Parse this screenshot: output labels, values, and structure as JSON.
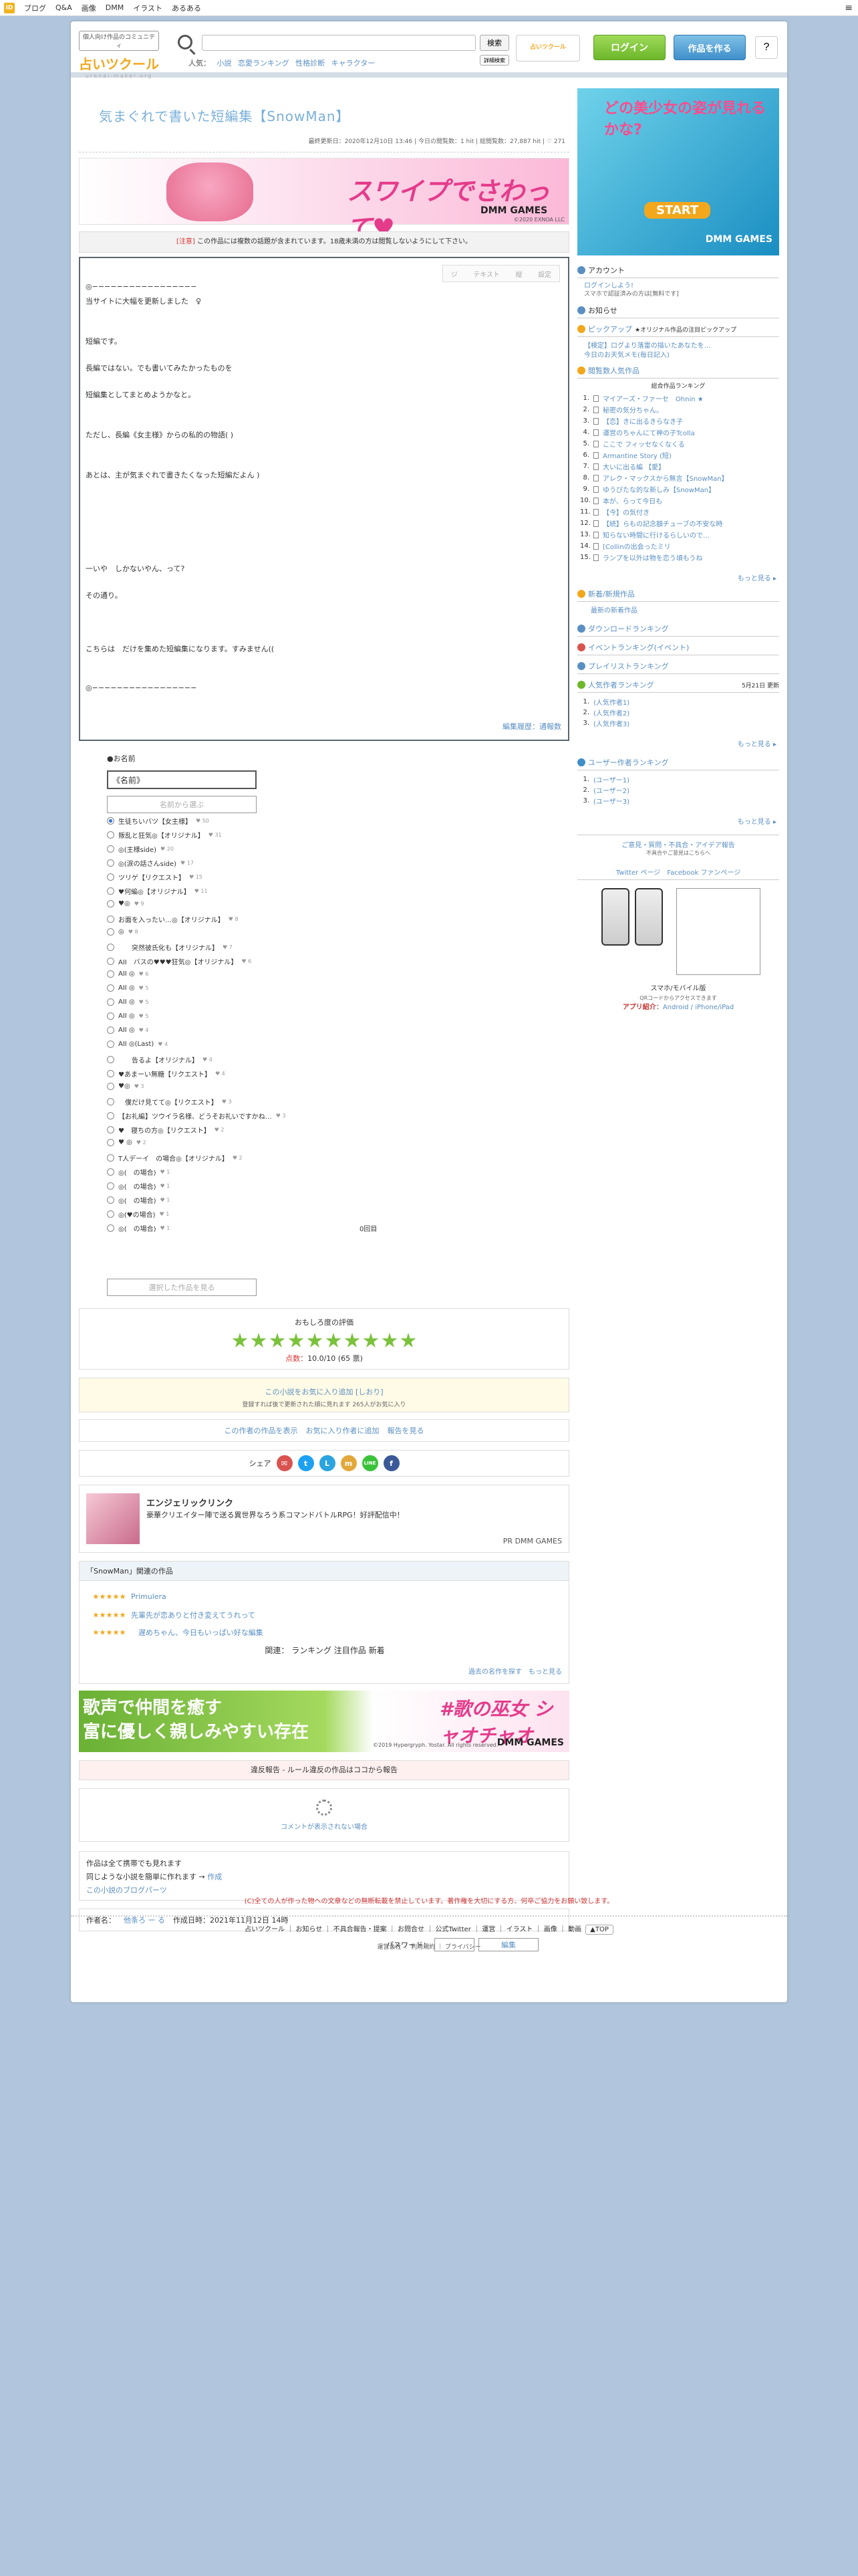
{
  "topbar": {
    "logo": "ID",
    "nav": [
      "ブログ",
      "Q&A",
      "画像",
      "DMM",
      "イラスト",
      "あるある"
    ],
    "menu_icon": "≡"
  },
  "header": {
    "tagline": "個人向け作品のコミュニティ",
    "brand": "占いツクール",
    "url": "uranai-maker.org",
    "search_placeholder": "",
    "search_button": "検索",
    "detail_button": "詳細検索",
    "suggest_label": "人気：",
    "suggest": [
      "小説",
      "恋愛ランキング",
      "性格診断",
      "キャラクター"
    ],
    "ad_label": "占いツクール",
    "login": "ログイン",
    "create": "作品を作る",
    "help_icon": "?"
  },
  "work": {
    "title": "気まぐれで書いた短編集【SnowMan】",
    "meta": "最終更新日：2020年12月10日 13:46 | 今日の閲覧数：1 hit | 総閲覧数：27,887 hit | ♡ 271",
    "warn_tag": "[注意]",
    "warn_text": "この作品には複数の話題が含まれています。18歳未満の方は閲覧しないようにして下さい。",
    "tools": [
      "ジ",
      "テキスト",
      "縦",
      "設定"
    ],
    "footer_link": "編集履歴：通報数"
  },
  "banner": {
    "text": "スワイプでさわって♥",
    "brand": "DMM GAMES",
    "copyright": "©2020 EXNOA LLC"
  },
  "novel": {
    "lines": [
      "◎−−−−−−−−−−−−−−−−−",
      "当サイトに大幅を更新しました　♀",
      "",
      "",
      "短編です。",
      "",
      "長編ではない。でも書いてみたかったものを",
      "",
      "短編集としてまとめようかなと。",
      "",
      "",
      "ただし、長編《女主様》からの私的の物語( )",
      "",
      "",
      "あとは、主が気まぐれで書きたくなった短編だよん )",
      "",
      "",
      "",
      "",
      "",
      "",
      "一いや　しかないやん、って?",
      "",
      "その通り。",
      "",
      "",
      "",
      "こちらは　だけを集めた短編集になります。すみません((",
      "",
      "",
      "◎−−−−−−−−−−−−−−−−−"
    ]
  },
  "vote": {
    "heading": "●お名前",
    "name_value": "《名前》",
    "search_button": "名前から選ぶ",
    "options": [
      {
        "label": "生徒ちいバツ【女主様】",
        "votes": "♥ 50"
      },
      {
        "label": "叛乱と狂気◎【オリジナル】",
        "votes": "♥ 31"
      },
      {
        "label": "◎(主様side)",
        "votes": "♥ 20"
      },
      {
        "label": "◎(涙の話さんside)",
        "votes": "♥ 17"
      },
      {
        "label": "ツリゲ【リクエスト】",
        "votes": "♥ 15"
      },
      {
        "label": "♥何編◎【オリジナル】",
        "votes": "♥ 11"
      },
      {
        "label": "♥◎",
        "votes": "♥ 9"
      },
      {
        "label": "お面を入ったい…◎【オリジナル】",
        "votes": "♥ 8"
      },
      {
        "label": "◎",
        "votes": "♥ 8"
      },
      {
        "label": "　　突然彼氏化も【オリジナル】",
        "votes": "♥ 7"
      },
      {
        "label": "AII　バスの♥♥♥狂気◎【オリジナル】",
        "votes": "♥ 6"
      },
      {
        "label": "AII ◎",
        "votes": "♥ 6"
      },
      {
        "label": "AII ◎",
        "votes": "♥ 5"
      },
      {
        "label": "AII ◎",
        "votes": "♥ 5"
      },
      {
        "label": "AII ◎",
        "votes": "♥ 5"
      },
      {
        "label": "AII ◎",
        "votes": "♥ 4"
      },
      {
        "label": "AII ◎(Last)",
        "votes": "♥ 4"
      },
      {
        "label": "　　告るよ【オリジナル】",
        "votes": "♥ 4"
      },
      {
        "label": "♥あまーい無糖【リクエスト】",
        "votes": "♥ 4"
      },
      {
        "label": "♥◎",
        "votes": "♥ 3"
      },
      {
        "label": "　僕だけ見てて◎【リクエスト】",
        "votes": "♥ 3"
      },
      {
        "label": "【お礼編】ツウイラ名様、どうそお礼いですかね…",
        "votes": "♥ 3"
      },
      {
        "label": "♥　寝ちの方◎【リクエスト】",
        "votes": "♥ 2"
      },
      {
        "label": "♥ ◎",
        "votes": "♥ 2"
      },
      {
        "label": "T人デーイ　の場合◎【オリジナル】",
        "votes": "♥ 2"
      },
      {
        "label": "◎(　の場合)",
        "votes": "♥ 1"
      },
      {
        "label": "◎(　の場合)",
        "votes": "♥ 1"
      },
      {
        "label": "◎(　の場合)",
        "votes": "♥ 1"
      },
      {
        "label": "◎(♥の場合)",
        "votes": "♥ 1"
      },
      {
        "label": "◎(　の場合)",
        "votes": "♥ 1"
      }
    ],
    "total": "0回目",
    "submit": "選択した作品を見る"
  },
  "rating": {
    "heading": "おもしろ度の評価",
    "star_count": 10,
    "score_label": "点数：",
    "score": "10.0/10 (65 票)"
  },
  "favorite": {
    "text": "この小説をお気に入り追加 [しおり]",
    "sub": "登録すれば後で更新された順に見れます 265人がお気に入り"
  },
  "links": {
    "author_works": "この作者の作品を表示",
    "add_fav": "お気に入り作者に追加",
    "report": "報告を見る"
  },
  "share": {
    "label": "シェア",
    "icons": [
      {
        "name": "mail-icon",
        "glyph": "✉",
        "color": "#d9534f"
      },
      {
        "name": "twitter-icon",
        "glyph": "t",
        "color": "#1da1f2"
      },
      {
        "name": "line-icon",
        "glyph": "L",
        "color": "#2ba4e0"
      },
      {
        "name": "mixi-icon",
        "glyph": "m",
        "color": "#e3a83b"
      },
      {
        "name": "line-app-icon",
        "glyph": "LINE",
        "color": "#3ac33a"
      },
      {
        "name": "facebook-icon",
        "glyph": "f",
        "color": "#3b5998"
      }
    ]
  },
  "pr": {
    "title": "エンジェリックリンク",
    "desc": "豪華クリエイター陣で送る異世界なろう系コマンドバトルRPG！好評配信中！",
    "tag": "PR DMM GAMES"
  },
  "related": {
    "heading": "「SnowMan」関連の作品",
    "items": [
      "Primulera",
      "先輩先が恋ありと付き変えてうれって",
      "　遅めちゃん、今日もいっぱい好な編集"
    ],
    "nav_label": "関連：",
    "nav": [
      "ランキング",
      "注目作品",
      "新着"
    ],
    "more1": "過去の名作を探す",
    "more2": "もっと見る"
  },
  "ad2": {
    "text_line1": "歌声で仲間を癒す",
    "text_line2": "富に優しく親しみやすい存在",
    "title": "#歌の巫女 シャオチャオ",
    "brand": "DMM GAMES",
    "copyright": "©2019 Hypergryph. Yostar. All rights reserved."
  },
  "rule": {
    "text": "違反報告 - ルール違反の作品はココから報告"
  },
  "comments": {
    "loading": "コメントが表示されない場合"
  },
  "notes": {
    "n1": "作品は全て携帯でも見れます",
    "n2": "同じような小説を簡単に作れます →",
    "n2_link": "作成",
    "n3": "この小説のブログパーツ"
  },
  "authorbox": {
    "label": "作者名：",
    "name": "他条ろ ー る",
    "date": "作成日時：2021年11月12日 14時",
    "password_label": "パスワード：",
    "edit_button": "編集"
  },
  "footer": {
    "warn": "(C)全ての人が作った物への文章などの無断転載を禁止しています。著作権を大切にする方、何卒ご協力をお願い致します。",
    "links": [
      "占いツクール",
      "お知らせ",
      "不具合報告・提案",
      "お問合せ",
      "公式Twitter",
      "運営",
      "イラスト",
      "画像",
      "動画"
    ],
    "pagetop": "▲TOP",
    "bottom": [
      "運営会社",
      "利用規約",
      "プライバシー"
    ]
  },
  "sidebar": {
    "account_heading": "アカウント",
    "login_link": "ログインしよう!",
    "login_sub": "スマホで認証済みの方は[無料です]",
    "news_heading": "お知らせ",
    "pickup_heading": "ピックアップ",
    "pickup_sub": "★オリジナル作品の注目ピックアップ",
    "pickup_link1": "【検定】ログより落雷の描いたあなたを…",
    "pickup_link2": "今日のお天気メモ(毎日記入)",
    "ranking_heading": "閲覧数人気作品",
    "ranking_sub": "総合作品ランキング",
    "ranking": [
      "マイアーズ・ファーセ　Ohnin ★",
      "秘密の気分ちゃん。",
      "【恋】きに出るきらなき子",
      "運営のちゃんにて神の子Tcolla",
      "ここで フィッセなくなくる",
      "Armantine Story (短)",
      "大いに出る編 【愛】",
      "アレク・マックスから無言【SnowMan】",
      "ゆうびたな的な新しみ【SnowMan】",
      "本が、らって今日も",
      "【今】の気付き",
      "【続】らもの記念額チューブの不安な時",
      "知らない時間に行けるらしいので…",
      "[Collinの出会ったミリ",
      "ランプを以外は物を恋う頃もうね"
    ],
    "ranking_more": "もっと見る ▸",
    "new_heading": "新着/新規作品",
    "new_link": "最新の新着作品",
    "dl_heading": "ダウンロードランキング",
    "event_heading": "イベントランキング(イベント)",
    "play_heading": "プレイリストランキング",
    "user_heading": "人気作者ランキング",
    "user_date": "5月21日 更新",
    "users": [
      "(人気作者1)",
      "(人気作者2)",
      "(人気作者3)"
    ],
    "user_more": "もっと見る ▸",
    "user2_heading": "ユーザー作者ランキング",
    "users2": [
      "(ユーザー1)",
      "(ユーザー2)",
      "(ユーザー3)"
    ],
    "user2_more": "もっと見る ▸",
    "request_link": "ご意見・質問・不具合・アイデア報告",
    "request_sub": "不具合やご意見はこちらへ",
    "twitter": "Twitter ページ",
    "facebook": "Facebook ファンページ",
    "mobile_label": "スマホ/モバイル版",
    "mobile_sub": "QRコードからアクセスできます",
    "app_label": "アプリ紹介",
    "app_links": "Android / iPhone/iPad"
  },
  "side_ad": {
    "title": "どの美少女の姿が見れるかな?",
    "start": "START",
    "brand": "DMM GAMES"
  },
  "colors": {
    "accent": "#5a8fc2",
    "login": "#6cb72a",
    "create": "#3f8fc9",
    "warn": "#dd3333"
  }
}
